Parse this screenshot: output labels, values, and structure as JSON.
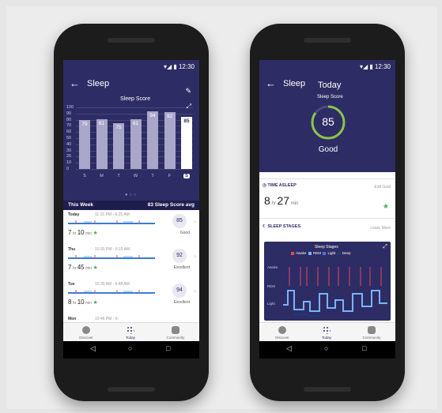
{
  "phone_left": {
    "status_time": "12:30",
    "title": "Sleep",
    "score_title": "Sleep Score",
    "y_axis": [
      "100",
      "90",
      "80",
      "70",
      "60",
      "50",
      "40",
      "30",
      "20",
      "10",
      "0"
    ],
    "chart_data": {
      "type": "bar",
      "categories": [
        "S",
        "M",
        "T",
        "W",
        "T",
        "F",
        "S"
      ],
      "values": [
        79,
        81,
        75,
        81,
        94,
        92,
        85
      ],
      "ylim": [
        0,
        100
      ],
      "ylabel": "",
      "xlabel": "",
      "title": "Sleep Score"
    },
    "week_label": "This Week",
    "week_avg": "83 Sleep Score avg",
    "entries": [
      {
        "day": "Today",
        "time": "11:15 PM - 6:25 AM",
        "hrs": "7",
        "mins": "10",
        "score": "85",
        "rating": "Good"
      },
      {
        "day": "Thu",
        "time": "10:30 PM - 6:15 AM",
        "hrs": "7",
        "mins": "45",
        "score": "92",
        "rating": "Excellent"
      },
      {
        "day": "Tue",
        "time": "10:30 AM - 6:48 AM",
        "hrs": "8",
        "mins": "10",
        "score": "94",
        "rating": "Excellent"
      },
      {
        "day": "Mon",
        "time": "10:46 PM - 6:",
        "hrs": "",
        "mins": "",
        "score": "",
        "rating": ""
      }
    ],
    "hr_unit": "hr",
    "min_unit": "min",
    "nav": {
      "discover": "Discover",
      "today": "Today",
      "community": "Community"
    }
  },
  "phone_right": {
    "status_time": "12:30",
    "title": "Sleep",
    "header_title": "Today",
    "score_title": "Sleep Score",
    "score": "85",
    "rating": "Good",
    "time_asleep_label": "TIME ASLEEP",
    "edit_goal": "Edit Goal",
    "hrs": "8",
    "mins": "27",
    "hr_unit": "hr",
    "min_unit": "min",
    "sleep_stages_label": "SLEEP STAGES",
    "learn_more": "Learn More",
    "stages_title": "Sleep Stages",
    "legend": [
      "Awake",
      "REM",
      "Light",
      "Deep"
    ],
    "stage_axis": [
      "Awake",
      "REM",
      "Light"
    ],
    "nav": {
      "discover": "Discover",
      "today": "Today",
      "community": "Community"
    }
  },
  "colors": {
    "header": "#2e2c64",
    "bar": "#a9a7c9",
    "accent_green": "#8bc34a",
    "awake": "#e2475f",
    "rem": "#78b4ff",
    "light": "#3a7bd5",
    "deep": "#1a3c7a"
  }
}
